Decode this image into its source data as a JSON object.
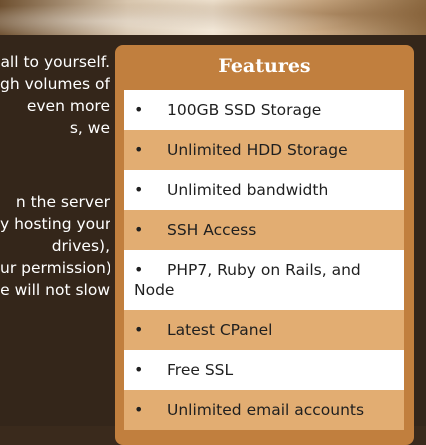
{
  "body_text": {
    "paragraph_1": [
      "all to yourself.",
      "gh volumes of",
      "even more",
      "s, we"
    ],
    "paragraph_2": [
      "n the server",
      "y hosting your",
      "drives),",
      "ur permission),",
      "e will not slow"
    ]
  },
  "features": {
    "title": "Features",
    "bullet": "•",
    "items": [
      "100GB SSD Storage",
      "Unlimited HDD Storage",
      "Unlimited bandwidth",
      "SSH Access",
      "PHP7, Ruby on Rails, and Node",
      "Latest CPanel",
      "Free SSL",
      "Unlimited email accounts"
    ]
  }
}
